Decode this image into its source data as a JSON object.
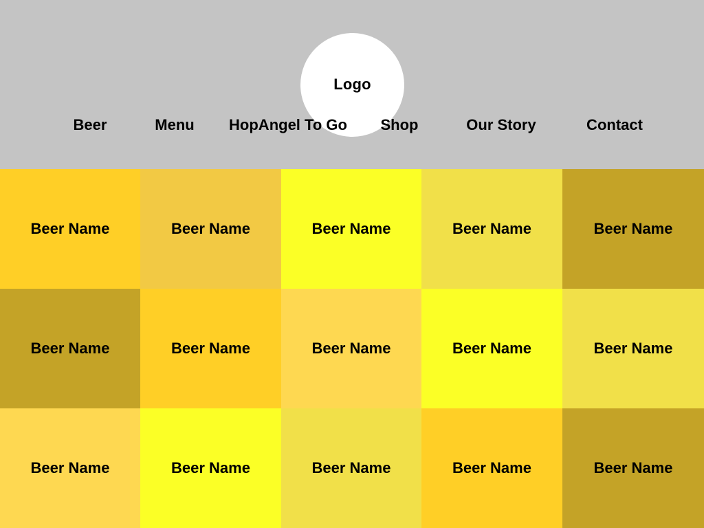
{
  "header": {
    "logo_text": "Logo",
    "nav": [
      {
        "label": "Beer"
      },
      {
        "label": "Menu"
      },
      {
        "label": "HopAngel To Go"
      },
      {
        "label": "Shop"
      },
      {
        "label": "Our Story"
      },
      {
        "label": "Contact"
      }
    ]
  },
  "colors": {
    "header_bg": "#c4c4c4",
    "logo_bg": "#ffffff",
    "amber": "#ffcf26",
    "golden": "#f2c944",
    "bright_yellow": "#fbff26",
    "pale_yellow": "#f1e049",
    "dark_gold": "#c4a327",
    "light_gold": "#fed851"
  },
  "beers": [
    {
      "name": "Beer Name",
      "color": "#ffcf26"
    },
    {
      "name": "Beer Name",
      "color": "#f2c944"
    },
    {
      "name": "Beer Name",
      "color": "#fbff26"
    },
    {
      "name": "Beer Name",
      "color": "#f1e049"
    },
    {
      "name": "Beer Name",
      "color": "#c4a327"
    },
    {
      "name": "Beer Name",
      "color": "#c4a327"
    },
    {
      "name": "Beer Name",
      "color": "#ffcf26"
    },
    {
      "name": "Beer Name",
      "color": "#fed851"
    },
    {
      "name": "Beer Name",
      "color": "#fbff26"
    },
    {
      "name": "Beer Name",
      "color": "#f1e049"
    },
    {
      "name": "Beer Name",
      "color": "#fed851"
    },
    {
      "name": "Beer Name",
      "color": "#fbff26"
    },
    {
      "name": "Beer Name",
      "color": "#f1e049"
    },
    {
      "name": "Beer Name",
      "color": "#ffcf26"
    },
    {
      "name": "Beer Name",
      "color": "#c4a327"
    }
  ]
}
